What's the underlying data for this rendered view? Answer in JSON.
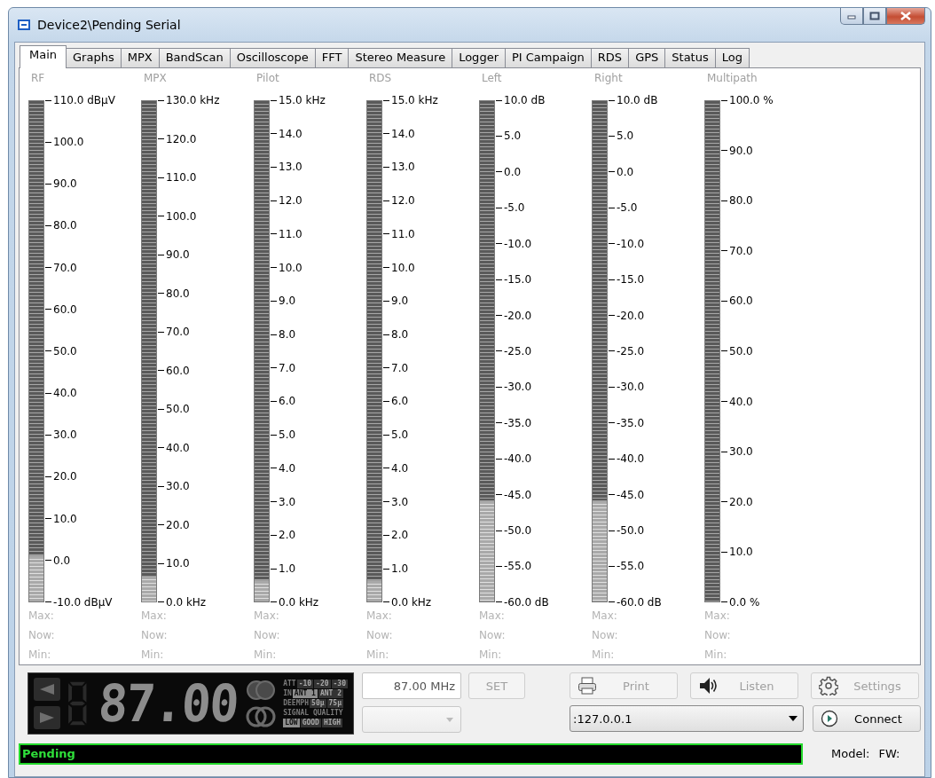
{
  "window": {
    "title": "Device2\\Pending Serial"
  },
  "tabs": [
    {
      "label": "Main",
      "selected": true
    },
    {
      "label": "Graphs",
      "selected": false
    },
    {
      "label": "MPX",
      "selected": false
    },
    {
      "label": "BandScan",
      "selected": false
    },
    {
      "label": "Oscilloscope",
      "selected": false
    },
    {
      "label": "FFT",
      "selected": false
    },
    {
      "label": "Stereo Measure",
      "selected": false
    },
    {
      "label": "Logger",
      "selected": false
    },
    {
      "label": "PI Campaign",
      "selected": false
    },
    {
      "label": "RDS",
      "selected": false
    },
    {
      "label": "GPS",
      "selected": false
    },
    {
      "label": "Status",
      "selected": false
    },
    {
      "label": "Log",
      "selected": false
    }
  ],
  "meters": [
    {
      "name": "RF",
      "level": 0.09,
      "scale": [
        "110.0 dBµV",
        "100.0",
        "90.0",
        "80.0",
        "70.0",
        "60.0",
        "50.0",
        "40.0",
        "30.0",
        "20.0",
        "10.0",
        "0.0",
        "-10.0 dBµV"
      ],
      "stats": [
        "Max:",
        "Now:",
        "Min:"
      ]
    },
    {
      "name": "MPX",
      "level": 0.05,
      "scale": [
        "130.0 kHz",
        "120.0",
        "110.0",
        "100.0",
        "90.0",
        "80.0",
        "70.0",
        "60.0",
        "50.0",
        "40.0",
        "30.0",
        "20.0",
        "10.0",
        "0.0 kHz"
      ],
      "stats": [
        "Max:",
        "Now:",
        "Min:"
      ]
    },
    {
      "name": "Pilot",
      "level": 0.04,
      "scale": [
        "15.0 kHz",
        "14.0",
        "13.0",
        "12.0",
        "11.0",
        "10.0",
        "9.0",
        "8.0",
        "7.0",
        "6.0",
        "5.0",
        "4.0",
        "3.0",
        "2.0",
        "1.0",
        "0.0 kHz"
      ],
      "stats": [
        "Max:",
        "Now:",
        "Min:"
      ]
    },
    {
      "name": "RDS",
      "level": 0.04,
      "scale": [
        "15.0 kHz",
        "14.0",
        "13.0",
        "12.0",
        "11.0",
        "10.0",
        "9.0",
        "8.0",
        "7.0",
        "6.0",
        "5.0",
        "4.0",
        "3.0",
        "2.0",
        "1.0",
        "0.0 kHz"
      ],
      "stats": [
        "Max:",
        "Now:",
        "Min:"
      ]
    },
    {
      "name": "Left",
      "level": 0.2,
      "scale": [
        "10.0 dB",
        "5.0",
        "0.0",
        "-5.0",
        "-10.0",
        "-15.0",
        "-20.0",
        "-25.0",
        "-30.0",
        "-35.0",
        "-40.0",
        "-45.0",
        "-50.0",
        "-55.0",
        "-60.0 dB"
      ],
      "stats": [
        "Max:",
        "Now:",
        "Min:"
      ]
    },
    {
      "name": "Right",
      "level": 0.2,
      "scale": [
        "10.0 dB",
        "5.0",
        "0.0",
        "-5.0",
        "-10.0",
        "-15.0",
        "-20.0",
        "-25.0",
        "-30.0",
        "-35.0",
        "-40.0",
        "-45.0",
        "-50.0",
        "-55.0",
        "-60.0 dB"
      ],
      "stats": [
        "Max:",
        "Now:",
        "Min:"
      ]
    },
    {
      "name": "Multipath",
      "level": 0,
      "scale": [
        "100.0 %",
        "90.0",
        "80.0",
        "70.0",
        "60.0",
        "50.0",
        "40.0",
        "30.0",
        "20.0",
        "10.0",
        "0.0 %"
      ],
      "stats": [
        "Max:",
        "Now:",
        "Min:"
      ]
    }
  ],
  "lcd": {
    "frequency": "87.00",
    "indicators": [
      {
        "label": "ATT",
        "options": [
          {
            "label": "-10",
            "selected": false
          },
          {
            "label": "-20",
            "selected": false
          },
          {
            "label": "-30",
            "selected": false
          }
        ]
      },
      {
        "label": "IN",
        "options": [
          {
            "label": "ANT 1",
            "selected": true
          },
          {
            "label": "ANT 2",
            "selected": false
          }
        ]
      },
      {
        "label": "DEEMPH",
        "options": [
          {
            "label": "50µ",
            "selected": false
          },
          {
            "label": "75µ",
            "selected": false
          }
        ]
      }
    ],
    "quality": {
      "label": "SIGNAL QUALITY",
      "options": [
        {
          "label": "LOW",
          "selected": true
        },
        {
          "label": "GOOD",
          "selected": false
        },
        {
          "label": "HIGH",
          "selected": false
        }
      ]
    }
  },
  "frequency_field": {
    "value": "87.00 MHz"
  },
  "set_button": {
    "label": "SET",
    "disabled": true
  },
  "buttons": [
    {
      "kind": "print",
      "label": "Print",
      "disabled": true
    },
    {
      "kind": "listen",
      "label": "Listen",
      "disabled": true
    },
    {
      "kind": "settings",
      "label": "Settings",
      "disabled": true
    }
  ],
  "host_combo": {
    "value": ":127.0.0.1"
  },
  "connect_button": {
    "label": "Connect",
    "disabled": false
  },
  "status_bar": {
    "status": "Pending",
    "model": "Model:",
    "firmware": "FW:"
  }
}
